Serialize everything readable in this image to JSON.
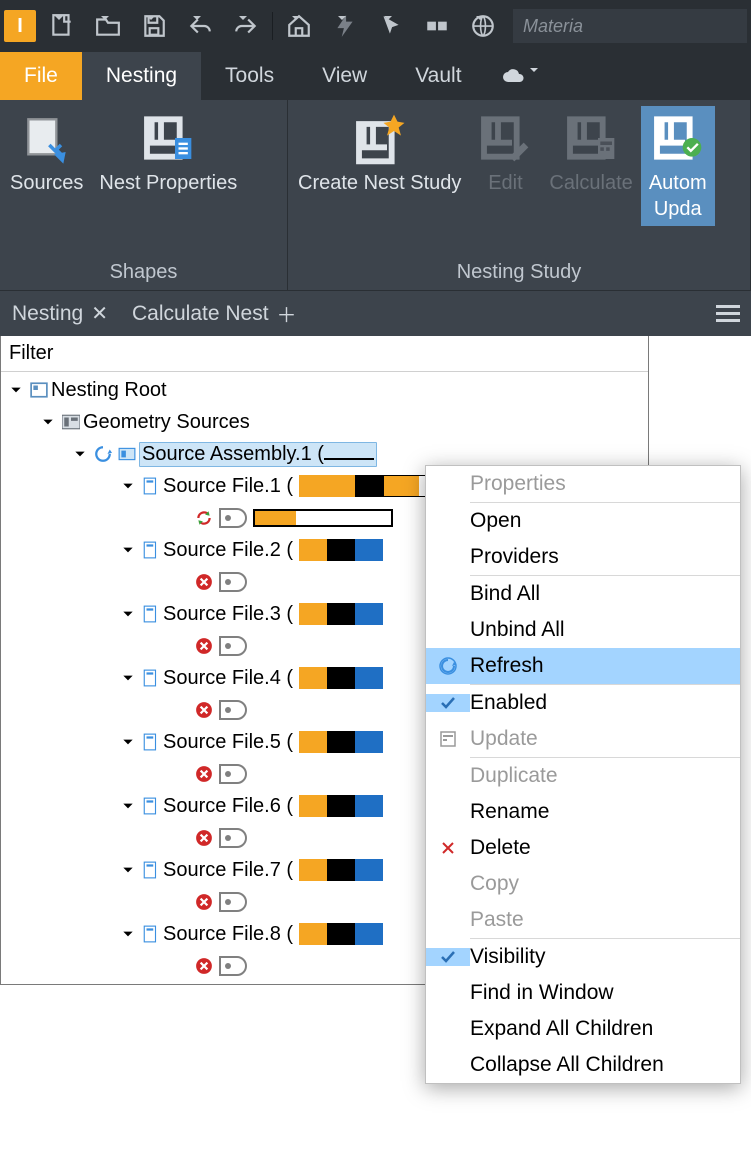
{
  "qat": {
    "material_placeholder": "Materia"
  },
  "tabs": {
    "file": "File",
    "nesting": "Nesting",
    "tools": "Tools",
    "view": "View",
    "vault": "Vault"
  },
  "ribbon": {
    "sources": "Sources",
    "nest_properties": "Nest Properties",
    "create_nest_study": "Create Nest Study",
    "edit": "Edit",
    "calculate": "Calculate",
    "auto_update": "Autom\nUpda",
    "group_shapes": "Shapes",
    "group_nesting_study": "Nesting Study"
  },
  "panel_tabs": {
    "nesting": "Nesting",
    "calculate_nest": "Calculate Nest"
  },
  "browser": {
    "filter": "Filter",
    "root": "Nesting Root",
    "geometry_sources": "Geometry Sources",
    "source_assembly": "Source Assembly.1 (",
    "files": [
      "Source File.1 (",
      "Source File.2 (",
      "Source File.3 (",
      "Source File.4 (",
      "Source File.5 (",
      "Source File.6 (",
      "Source File.7 (",
      "Source File.8 ("
    ]
  },
  "context_menu": {
    "properties": "Properties",
    "open": "Open",
    "providers": "Providers",
    "bind_all": "Bind All",
    "unbind_all": "Unbind All",
    "refresh": "Refresh",
    "enabled": "Enabled",
    "update": "Update",
    "duplicate": "Duplicate",
    "rename": "Rename",
    "delete": "Delete",
    "copy": "Copy",
    "paste": "Paste",
    "visibility": "Visibility",
    "find_in_window": "Find in Window",
    "expand_all": "Expand All Children",
    "collapse_all": "Collapse All Children"
  }
}
